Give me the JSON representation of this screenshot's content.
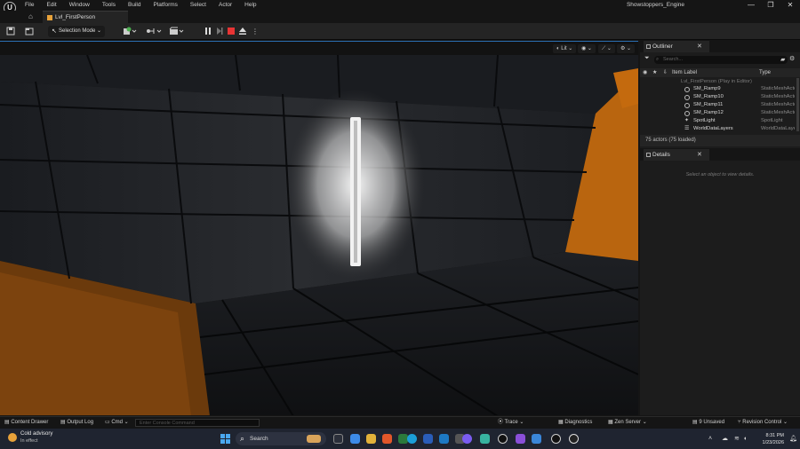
{
  "menubar": {
    "logo": "U",
    "menus": [
      "File",
      "Edit",
      "Window",
      "Tools",
      "Build",
      "Platforms",
      "Select",
      "Actor",
      "Help"
    ],
    "project_name": "Showstoppers_Engine",
    "window_buttons": [
      "—",
      "❐",
      "✕"
    ]
  },
  "tabs": {
    "home_icon": "⌂",
    "level_tab": "Lvl_FirstPerson"
  },
  "toolbar": {
    "selection_mode": "Selection Mode"
  },
  "viewport": {
    "view_mode": "Lit"
  },
  "outliner": {
    "title": "Outliner",
    "close": "✕",
    "search_placeholder": "Search...",
    "col_label": "Item Label",
    "col_type": "Type",
    "root_row": "Lvl_FirstPerson (Play in Editor)",
    "rows": [
      {
        "name": "SM_Ramp9",
        "type": "StaticMeshActor"
      },
      {
        "name": "SM_Ramp10",
        "type": "StaticMeshActor"
      },
      {
        "name": "SM_Ramp11",
        "type": "StaticMeshActor"
      },
      {
        "name": "SM_Ramp12",
        "type": "StaticMeshActor"
      },
      {
        "name": "SpotLight",
        "type": "SpotLight"
      },
      {
        "name": "WorldDataLayers",
        "type": "WorldDataLayers"
      }
    ],
    "actor_count": "75 actors (75 loaded)"
  },
  "details": {
    "title": "Details",
    "close": "✕",
    "hint": "Select an object to view details."
  },
  "statusbar": {
    "content_drawer": "Content Drawer",
    "output_log": "Output Log",
    "cmd": "Cmd",
    "console_placeholder": "Enter Console Command",
    "trace": "Trace",
    "diagnostics": "Diagnostics",
    "zen_server": "Zen Server",
    "unsaved": "9 Unsaved",
    "revision_control": "Revision Control"
  },
  "taskbar": {
    "weather_line1": "Cold advisory",
    "weather_line2": "In effect",
    "search_label": "Search",
    "time": "8:31 PM",
    "date": "1/23/2026"
  },
  "colors": {
    "accent_blue": "#2a6db0",
    "orange_wall": "#c46a0e",
    "level_tab_icon": "#e8a23a"
  }
}
